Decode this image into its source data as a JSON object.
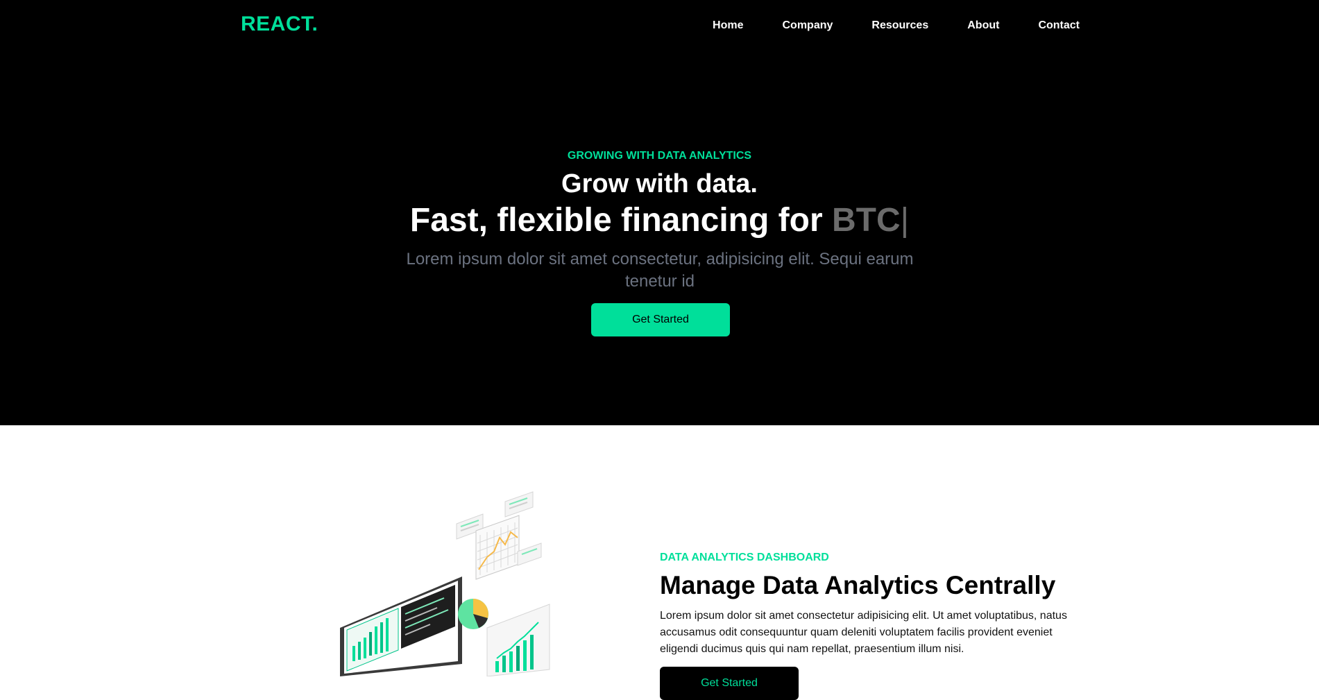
{
  "brand": {
    "logo": "REACT."
  },
  "nav": {
    "items": [
      "Home",
      "Company",
      "Resources",
      "About",
      "Contact"
    ]
  },
  "hero": {
    "eyebrow": "GROWING WITH DATA ANALYTICS",
    "title": "Grow with data.",
    "subtitle_prefix": "Fast, flexible financing for",
    "typed_text": "BTC",
    "caret": "|",
    "description": "Lorem ipsum dolor sit amet consectetur, adipisicing elit. Sequi earum tenetur id",
    "cta_label": "Get Started"
  },
  "analytics": {
    "eyebrow": "DATA ANALYTICS DASHBOARD",
    "title": "Manage Data Analytics Centrally",
    "description": "Lorem ipsum dolor sit amet consectetur adipisicing elit. Ut amet voluptatibus, natus accusamus odit consequuntur quam deleniti voluptatem facilis provident eveniet eligendi ducimus quis qui nam repellat, praesentium illum nisi.",
    "cta_label": "Get Started"
  },
  "colors": {
    "accent": "#00df9a",
    "background_dark": "#000000",
    "muted_text": "#6b7280"
  }
}
